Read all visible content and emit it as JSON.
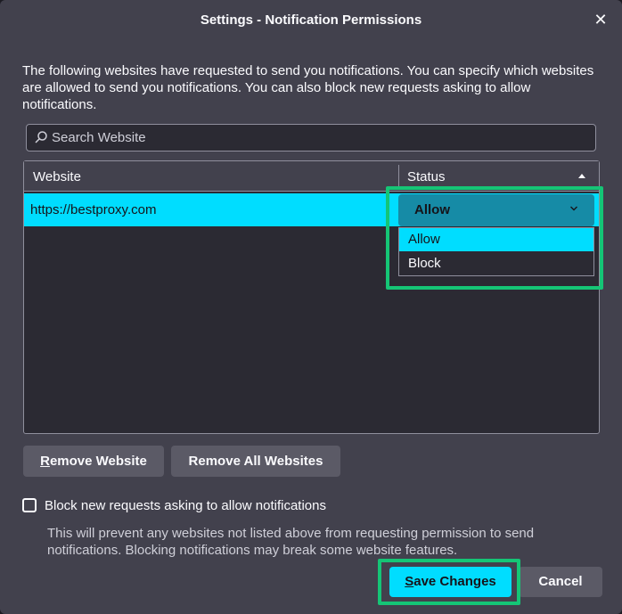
{
  "dialog": {
    "title": "Settings - Notification Permissions",
    "close_icon": "close-icon",
    "description": "The following websites have requested to send you notifications. You can specify which websites are allowed to send you notifications. You can also block new requests asking to allow notifications."
  },
  "search": {
    "placeholder": "Search Website",
    "icon": "search-icon"
  },
  "table": {
    "headers": {
      "website": "Website",
      "status": "Status"
    },
    "sort": "status-ascending",
    "rows": [
      {
        "website": "https://bestproxy.com",
        "status": "Allow"
      }
    ],
    "status_options": [
      "Allow",
      "Block"
    ],
    "selected_option": "Allow"
  },
  "buttons": {
    "remove_website": "Remove Website",
    "remove_all": "Remove All Websites",
    "save": "Save Changes",
    "cancel": "Cancel"
  },
  "block_requests": {
    "checked": false,
    "label": "Block new requests asking to allow notifications",
    "note": "This will prevent any websites not listed above from requesting permission to send notifications. Blocking notifications may break some website features."
  },
  "colors": {
    "accent": "#00ddff",
    "highlight_box": "#15c576",
    "dialog_bg": "#42414d"
  }
}
